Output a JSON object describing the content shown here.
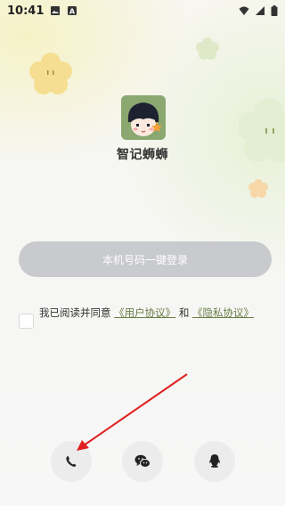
{
  "status_bar": {
    "time": "10:41",
    "icons": [
      "gallery-icon",
      "a-badge-icon",
      "wifi-icon",
      "signal-icon",
      "battery-icon"
    ]
  },
  "app": {
    "name": "智记蛳蛳"
  },
  "login": {
    "button_label": "本机号码一键登录"
  },
  "agreement": {
    "checked": false,
    "prefix": "我已阅读并同意",
    "user_agreement": "《用户协议》",
    "and": "和",
    "privacy_agreement": "《隐私协议》"
  },
  "social_login": {
    "buttons": [
      {
        "name": "phone-login",
        "icon": "phone-icon"
      },
      {
        "name": "wechat-login",
        "icon": "wechat-icon"
      },
      {
        "name": "qq-login",
        "icon": "qq-icon"
      }
    ]
  },
  "colors": {
    "login_button": "#c9cacd",
    "link": "#6a7d45",
    "annotation_arrow": "#e02020"
  }
}
